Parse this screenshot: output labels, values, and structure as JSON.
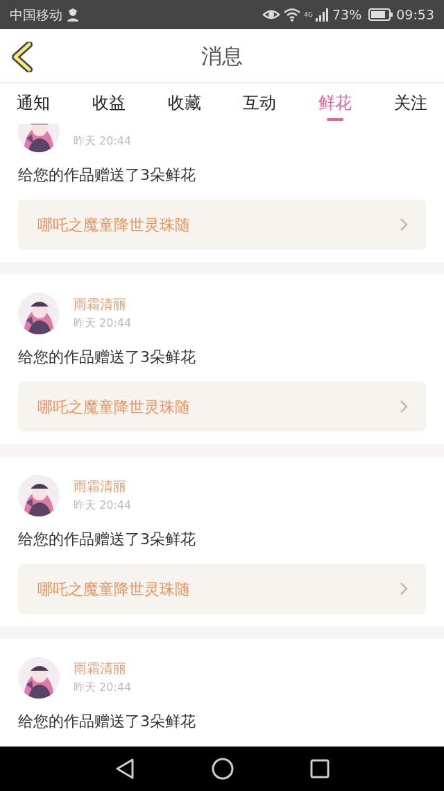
{
  "status_bar": {
    "carrier": "中国移动",
    "network": "4G",
    "battery": "73%",
    "time": "09:53"
  },
  "header": {
    "title": "消息"
  },
  "tabs": [
    {
      "label": "通知",
      "selected": false
    },
    {
      "label": "收益",
      "selected": false
    },
    {
      "label": "收藏",
      "selected": false
    },
    {
      "label": "互动",
      "selected": false
    },
    {
      "label": "鲜花",
      "selected": true
    },
    {
      "label": "关注",
      "selected": false
    }
  ],
  "messages": [
    {
      "time": "昨天 20:44",
      "text": "给您的作品赠送了3朵鲜花",
      "work": "哪吒之魔童降世灵珠随"
    },
    {
      "name": "雨霜清丽",
      "time": "昨天 20:44",
      "text": "给您的作品赠送了3朵鲜花",
      "work": "哪吒之魔童降世灵珠随"
    },
    {
      "name": "雨霜清丽",
      "time": "昨天 20:44",
      "text": "给您的作品赠送了3朵鲜花",
      "work": "哪吒之魔童降世灵珠随"
    },
    {
      "name": "雨霜清丽",
      "time": "昨天 20:44",
      "text": "给您的作品赠送了3朵鲜花"
    }
  ]
}
